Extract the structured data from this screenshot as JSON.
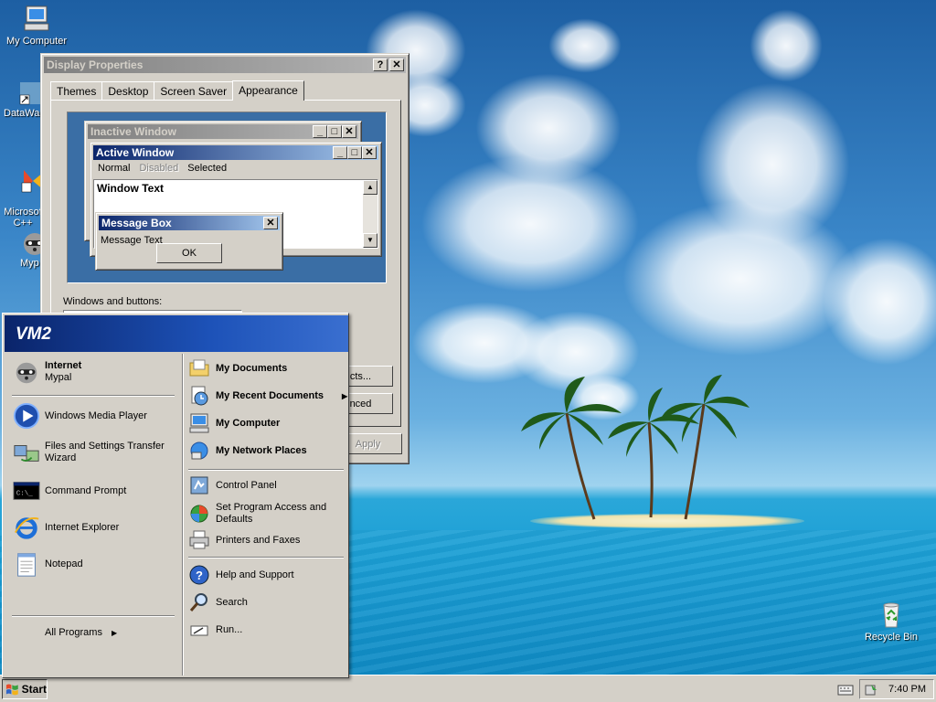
{
  "desktop": {
    "icons": [
      {
        "label": "My Computer",
        "icon": "my-computer-icon"
      },
      {
        "label": "DataWa",
        "icon": "shortcut-icon"
      },
      {
        "label": "Microsof\nC++",
        "icon": "visual-cpp-icon"
      },
      {
        "label": "Myp",
        "icon": "raccoon-icon"
      },
      {
        "label": "Recycle Bin",
        "icon": "recycle-bin-icon"
      }
    ]
  },
  "display_properties": {
    "title": "Display Properties",
    "tabs": [
      "Themes",
      "Desktop",
      "Screen Saver",
      "Appearance"
    ],
    "selected_tab": "Appearance",
    "preview": {
      "inactive_title": "Inactive Window",
      "active_title": "Active Window",
      "menu": [
        "Normal",
        "Disabled",
        "Selected"
      ],
      "window_text": "Window Text",
      "message_box_title": "Message Box",
      "message_text": "Message Text",
      "ok_label": "OK"
    },
    "windows_buttons_label": "Windows and buttons:",
    "effects_label": "cts...",
    "advanced_label": "nced",
    "apply_label": "Apply"
  },
  "start_menu": {
    "user": "VM2",
    "pinned": [
      {
        "title": "Internet",
        "subtitle": "Mypal",
        "icon": "raccoon-icon"
      }
    ],
    "recent": [
      {
        "label": "Windows Media Player",
        "icon": "media-player-icon"
      },
      {
        "label": "Files and Settings Transfer Wizard",
        "icon": "transfer-wizard-icon"
      },
      {
        "label": "Command Prompt",
        "icon": "command-prompt-icon"
      },
      {
        "label": "Internet Explorer",
        "icon": "internet-explorer-icon"
      },
      {
        "label": "Notepad",
        "icon": "notepad-icon"
      }
    ],
    "all_programs": "All Programs",
    "right_top": [
      {
        "label": "My Documents",
        "icon": "folder-icon"
      },
      {
        "label": "My Recent Documents",
        "icon": "recent-documents-icon"
      },
      {
        "label": "My Computer",
        "icon": "my-computer-icon"
      },
      {
        "label": "My Network Places",
        "icon": "network-icon"
      }
    ],
    "right_mid": [
      {
        "label": "Control Panel",
        "icon": "control-panel-icon"
      },
      {
        "label": "Set Program Access and Defaults",
        "icon": "program-access-icon"
      },
      {
        "label": "Printers and Faxes",
        "icon": "printer-icon"
      }
    ],
    "right_bottom": [
      {
        "label": "Help and Support",
        "icon": "help-icon"
      },
      {
        "label": "Search",
        "icon": "search-icon"
      },
      {
        "label": "Run...",
        "icon": "run-icon"
      }
    ]
  },
  "taskbar": {
    "start_label": "Start",
    "clock": "7:40 PM"
  }
}
